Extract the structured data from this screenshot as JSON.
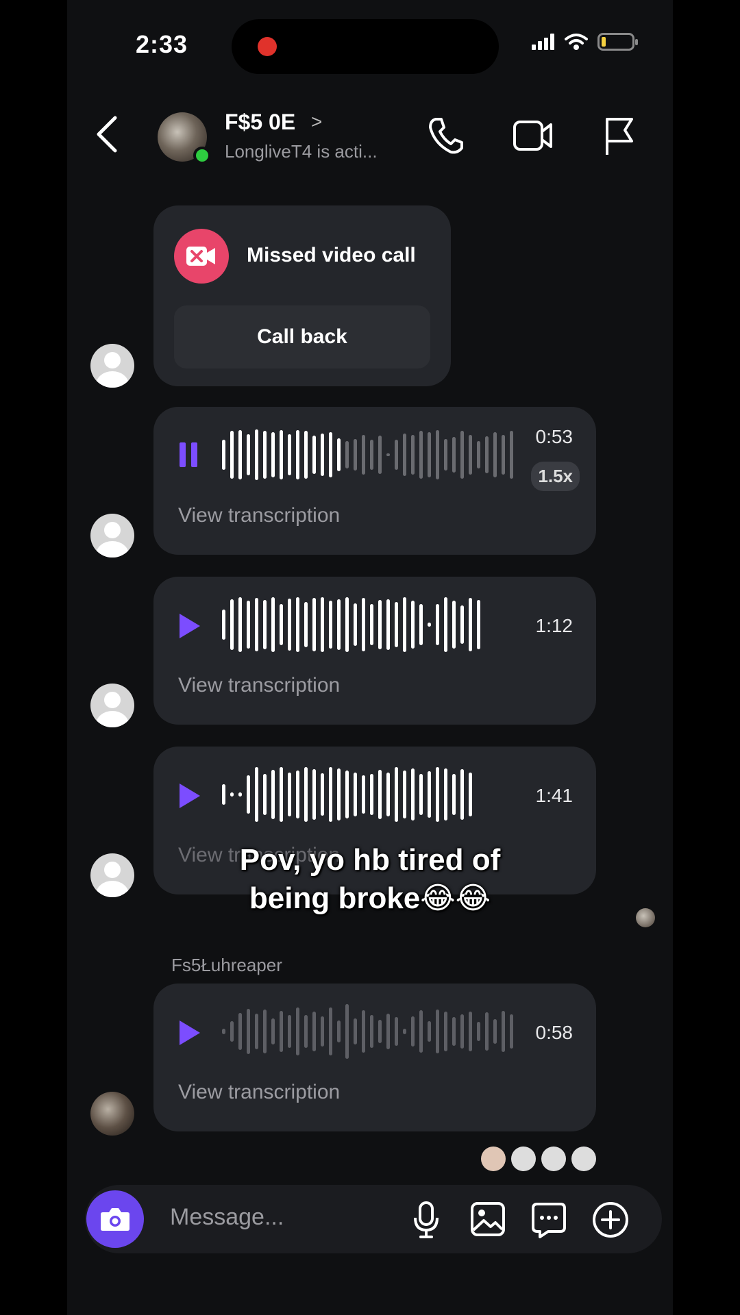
{
  "status": {
    "time": "2:33"
  },
  "header": {
    "name": "F$5 0E",
    "chevron": ">",
    "subtitle": "LongliveT4 is acti...",
    "icons": [
      "back-icon",
      "phone-icon",
      "video-camera-icon",
      "flag-icon"
    ]
  },
  "messages": {
    "missed_call": {
      "label": "Missed video call",
      "action": "Call back"
    },
    "voice": [
      {
        "duration": "0:53",
        "speed": "1.5x",
        "transcription": "View transcription",
        "state": "playing",
        "progress": 0.4
      },
      {
        "duration": "1:12",
        "transcription": "View transcription",
        "state": "paused"
      },
      {
        "duration": "1:41",
        "transcription": "View transcription",
        "state": "paused"
      },
      {
        "duration": "0:58",
        "transcription": "View transcription",
        "state": "paused"
      }
    ],
    "sender_name": "Fs5Łuhreaper"
  },
  "overlay": {
    "caption": "Pov, yo hb tired of being broke😂😂"
  },
  "composer": {
    "placeholder": "Message..."
  },
  "colors": {
    "accent": "#6b46ee",
    "play": "#7c4dff",
    "missed": "#e8456a",
    "online": "#2ecc40",
    "bubble": "#24262b"
  }
}
